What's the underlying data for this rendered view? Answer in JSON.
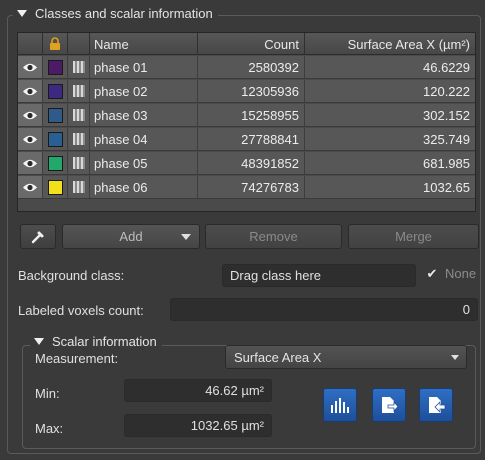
{
  "panel": {
    "title": "Classes and scalar information"
  },
  "table": {
    "headers": {
      "name": "Name",
      "count": "Count",
      "area": "Surface Area X (µm²)"
    },
    "rows": [
      {
        "name": "phase 01",
        "count": "2580392",
        "area": "46.6229",
        "color": "#4d1a66"
      },
      {
        "name": "phase 02",
        "count": "12305936",
        "area": "120.222",
        "color": "#3d2a80"
      },
      {
        "name": "phase 03",
        "count": "15258955",
        "area": "302.152",
        "color": "#2f5a8a"
      },
      {
        "name": "phase 04",
        "count": "27788841",
        "area": "325.749",
        "color": "#2a5f94"
      },
      {
        "name": "phase 05",
        "count": "48391852",
        "area": "681.985",
        "color": "#22a86a"
      },
      {
        "name": "phase 06",
        "count": "74276783",
        "area": "1032.65",
        "color": "#f2e01a"
      }
    ]
  },
  "toolbar": {
    "add": "Add",
    "remove": "Remove",
    "merge": "Merge"
  },
  "background": {
    "label": "Background class:",
    "field": "Drag class here",
    "none_label": "None",
    "none_checked": true
  },
  "labeled": {
    "label": "Labeled voxels count:",
    "value": "0"
  },
  "scalar": {
    "title": "Scalar information",
    "measurement_label": "Measurement:",
    "measurement_value": "Surface Area X",
    "min_label": "Min:",
    "min_value": "46.62 µm²",
    "max_label": "Max:",
    "max_value": "1032.65 µm²"
  },
  "colors": {
    "accent": "#2a62b8",
    "background": "#3a3a3a"
  },
  "icons": [
    "visibility-eye-icon",
    "lock-icon",
    "eyedropper-icon",
    "dropdown-arrow-icon",
    "histogram-icon",
    "export-icon",
    "export-alt-icon"
  ]
}
